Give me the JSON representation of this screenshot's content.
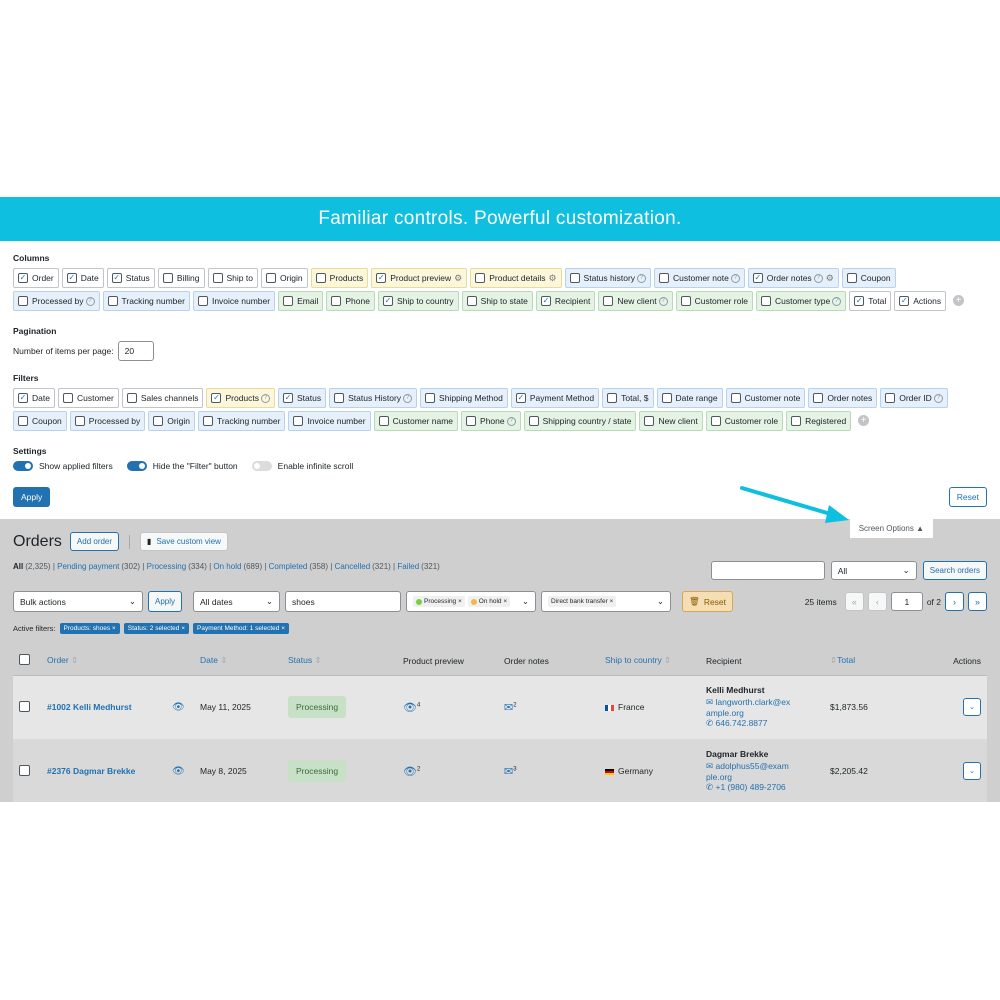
{
  "banner": "Familiar controls. Powerful customization.",
  "columns_title": "Columns",
  "columns": [
    {
      "label": "Order",
      "checked": true,
      "style": "plain"
    },
    {
      "label": "Date",
      "checked": true,
      "style": "plain"
    },
    {
      "label": "Status",
      "checked": true,
      "style": "plain"
    },
    {
      "label": "Billing",
      "checked": false,
      "style": "plain"
    },
    {
      "label": "Ship to",
      "checked": false,
      "style": "plain"
    },
    {
      "label": "Origin",
      "checked": false,
      "style": "plain"
    },
    {
      "label": "Products",
      "checked": false,
      "style": "yellow"
    },
    {
      "label": "Product preview",
      "checked": true,
      "style": "yellow",
      "gear": true
    },
    {
      "label": "Product details",
      "checked": false,
      "style": "yellow",
      "gear": true
    },
    {
      "label": "Status history",
      "checked": false,
      "style": "blue",
      "help": true
    },
    {
      "label": "Customer note",
      "checked": false,
      "style": "blue",
      "help": true
    },
    {
      "label": "Order notes",
      "checked": true,
      "style": "blue",
      "help": true,
      "gear": true
    },
    {
      "label": "Coupon",
      "checked": false,
      "style": "blue"
    },
    {
      "label": "Processed by",
      "checked": false,
      "style": "blue",
      "help": true
    },
    {
      "label": "Tracking number",
      "checked": false,
      "style": "blue"
    },
    {
      "label": "Invoice number",
      "checked": false,
      "style": "blue"
    },
    {
      "label": "Email",
      "checked": false,
      "style": "green"
    },
    {
      "label": "Phone",
      "checked": false,
      "style": "green"
    },
    {
      "label": "Ship to country",
      "checked": true,
      "style": "green"
    },
    {
      "label": "Ship to state",
      "checked": false,
      "style": "green"
    },
    {
      "label": "Recipient",
      "checked": true,
      "style": "green"
    },
    {
      "label": "New client",
      "checked": false,
      "style": "green",
      "help": true
    },
    {
      "label": "Customer role",
      "checked": false,
      "style": "green"
    },
    {
      "label": "Customer type",
      "checked": false,
      "style": "green",
      "help": true
    },
    {
      "label": "Total",
      "checked": true,
      "style": "plain"
    },
    {
      "label": "Actions",
      "checked": true,
      "style": "plain"
    }
  ],
  "pagination_title": "Pagination",
  "items_per_page_label": "Number of items per page:",
  "items_per_page": "20",
  "filters_title": "Filters",
  "filters": [
    {
      "label": "Date",
      "checked": true,
      "style": "plain"
    },
    {
      "label": "Customer",
      "checked": false,
      "style": "plain"
    },
    {
      "label": "Sales channels",
      "checked": false,
      "style": "plain"
    },
    {
      "label": "Products",
      "checked": true,
      "style": "yellow",
      "help": true
    },
    {
      "label": "Status",
      "checked": true,
      "style": "blue"
    },
    {
      "label": "Status History",
      "checked": false,
      "style": "blue",
      "help": true
    },
    {
      "label": "Shipping Method",
      "checked": false,
      "style": "blue"
    },
    {
      "label": "Payment Method",
      "checked": true,
      "style": "blue"
    },
    {
      "label": "Total, $",
      "checked": false,
      "style": "blue"
    },
    {
      "label": "Date range",
      "checked": false,
      "style": "blue"
    },
    {
      "label": "Customer note",
      "checked": false,
      "style": "blue"
    },
    {
      "label": "Order notes",
      "checked": false,
      "style": "blue"
    },
    {
      "label": "Order ID",
      "checked": false,
      "style": "blue",
      "help": true
    },
    {
      "label": "Coupon",
      "checked": false,
      "style": "blue"
    },
    {
      "label": "Processed by",
      "checked": false,
      "style": "blue"
    },
    {
      "label": "Origin",
      "checked": false,
      "style": "blue"
    },
    {
      "label": "Tracking number",
      "checked": false,
      "style": "blue"
    },
    {
      "label": "Invoice number",
      "checked": false,
      "style": "blue"
    },
    {
      "label": "Customer name",
      "checked": false,
      "style": "green"
    },
    {
      "label": "Phone",
      "checked": false,
      "style": "green",
      "help": true
    },
    {
      "label": "Shipping country / state",
      "checked": false,
      "style": "green"
    },
    {
      "label": "New client",
      "checked": false,
      "style": "green"
    },
    {
      "label": "Customer role",
      "checked": false,
      "style": "green"
    },
    {
      "label": "Registered",
      "checked": false,
      "style": "green"
    }
  ],
  "settings_title": "Settings",
  "settings": [
    {
      "label": "Show applied filters",
      "on": true
    },
    {
      "label": "Hide the \"Filter\" button",
      "on": true
    },
    {
      "label": "Enable infinite scroll",
      "on": false
    }
  ],
  "apply_label": "Apply",
  "reset_label": "Reset",
  "screen_options": "Screen Options ▲",
  "orders": {
    "title": "Orders",
    "add_order": "Add order",
    "save_view": "Save custom view",
    "status_links": [
      {
        "label": "All",
        "count": "(2,325)",
        "current": true
      },
      {
        "label": "Pending payment",
        "count": "(302)"
      },
      {
        "label": "Processing",
        "count": "(334)"
      },
      {
        "label": "On hold",
        "count": "(689)"
      },
      {
        "label": "Completed",
        "count": "(358)"
      },
      {
        "label": "Cancelled",
        "count": "(321)"
      },
      {
        "label": "Failed",
        "count": "(321)"
      }
    ],
    "search_value": "",
    "search_scope": "All",
    "search_button": "Search orders",
    "bulk_actions": "Bulk actions",
    "apply": "Apply",
    "all_dates": "All dates",
    "product_filter": "shoes",
    "status_tags": [
      "Processing ×",
      "On hold ×"
    ],
    "status_colors": [
      "#7ad03a",
      "#f0b849"
    ],
    "payment_tag": "Direct bank transfer ×",
    "reset": "Reset",
    "items_count": "25 items",
    "page_first": "«",
    "page_prev": "‹",
    "page_current": "1",
    "page_of": "of 2",
    "page_next": "›",
    "page_last": "»",
    "active_filters_label": "Active filters:",
    "active_filters": [
      "Products: shoes ×",
      "Status: 2 selected ×",
      "Payment Method: 1 selected ×"
    ],
    "headers": {
      "order": "Order",
      "date": "Date",
      "status": "Status",
      "preview": "Product preview",
      "notes": "Order notes",
      "country": "Ship to country",
      "recipient": "Recipient",
      "total": "Total",
      "actions": "Actions"
    },
    "rows": [
      {
        "order": "#1002 Kelli Medhurst",
        "date": "May 11, 2025",
        "status": "Processing",
        "preview_count": "4",
        "notes_count": "2",
        "country": "France",
        "flag": [
          "#0055a4",
          "#ffffff",
          "#ef4135"
        ],
        "name": "Kelli Medhurst",
        "email1": "langworth.clark@ex",
        "email2": "ample.org",
        "phone": "646.742.8877",
        "total": "$1,873.56"
      },
      {
        "order": "#2376 Dagmar Brekke",
        "date": "May 8, 2025",
        "status": "Processing",
        "preview_count": "2",
        "notes_count": "3",
        "country": "Germany",
        "flag": [
          "#000000",
          "#dd0000",
          "#ffce00"
        ],
        "name": "Dagmar Brekke",
        "email1": "adolphus55@exam",
        "email2": "ple.org",
        "phone": "+1 (980) 489-2706",
        "total": "$2,205.42"
      }
    ]
  }
}
